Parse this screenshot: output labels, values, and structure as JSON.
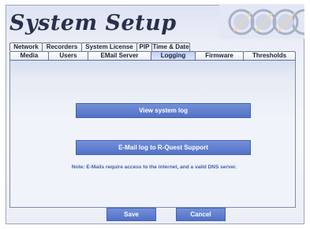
{
  "header": {
    "title": "System Setup"
  },
  "tabs": {
    "back_row": [
      {
        "label": "Network"
      },
      {
        "label": "Recorders"
      },
      {
        "label": "System License"
      },
      {
        "label": "PIP"
      },
      {
        "label": "Time & Date"
      }
    ],
    "front_row": [
      {
        "label": "Media"
      },
      {
        "label": "Users"
      },
      {
        "label": "EMail Server"
      },
      {
        "label": "Logging",
        "active": true
      },
      {
        "label": "Firmware"
      },
      {
        "label": "Thresholds"
      }
    ]
  },
  "logging": {
    "view_log_label": "View system log",
    "email_log_label": "E-Mail log to R-Quest Support",
    "note": "Note: E-Mails require access to the internet, and a valid DNS server."
  },
  "footer": {
    "save_label": "Save",
    "cancel_label": "Cancel"
  },
  "colors": {
    "accent": "#5372c6",
    "title": "#2a2f4d",
    "note": "#3d5fae"
  }
}
